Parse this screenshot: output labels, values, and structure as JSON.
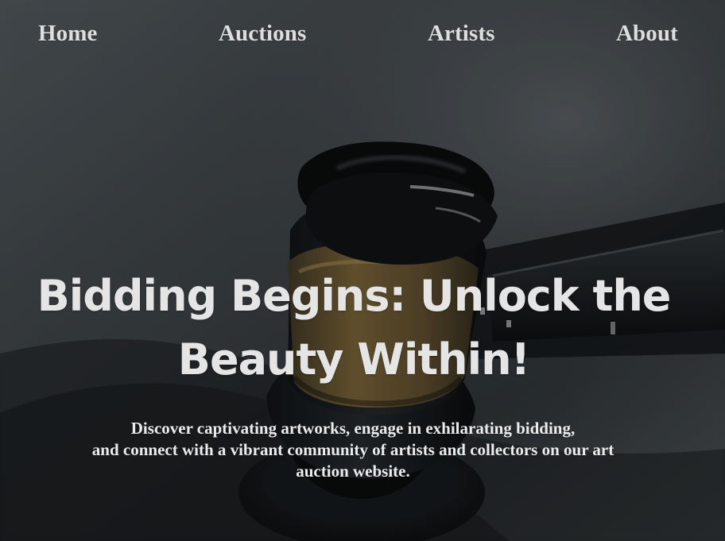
{
  "nav": {
    "items": [
      {
        "label": "Home"
      },
      {
        "label": "Auctions"
      },
      {
        "label": "Artists"
      },
      {
        "label": "About"
      }
    ]
  },
  "hero": {
    "background_image": "judge-gavel-photo",
    "title": "Bidding Begins: Unlock the Beauty Within!",
    "description": {
      "line1": "Discover captivating artworks, engage in exhilarating bidding,",
      "line2": "and connect with a vibrant community of artists and collectors on our art",
      "line3": "auction website."
    }
  },
  "colors": {
    "overlay_dark": "#3a3f42",
    "text_primary": "#e5e5e5",
    "gavel_band": "#6f5a32"
  }
}
